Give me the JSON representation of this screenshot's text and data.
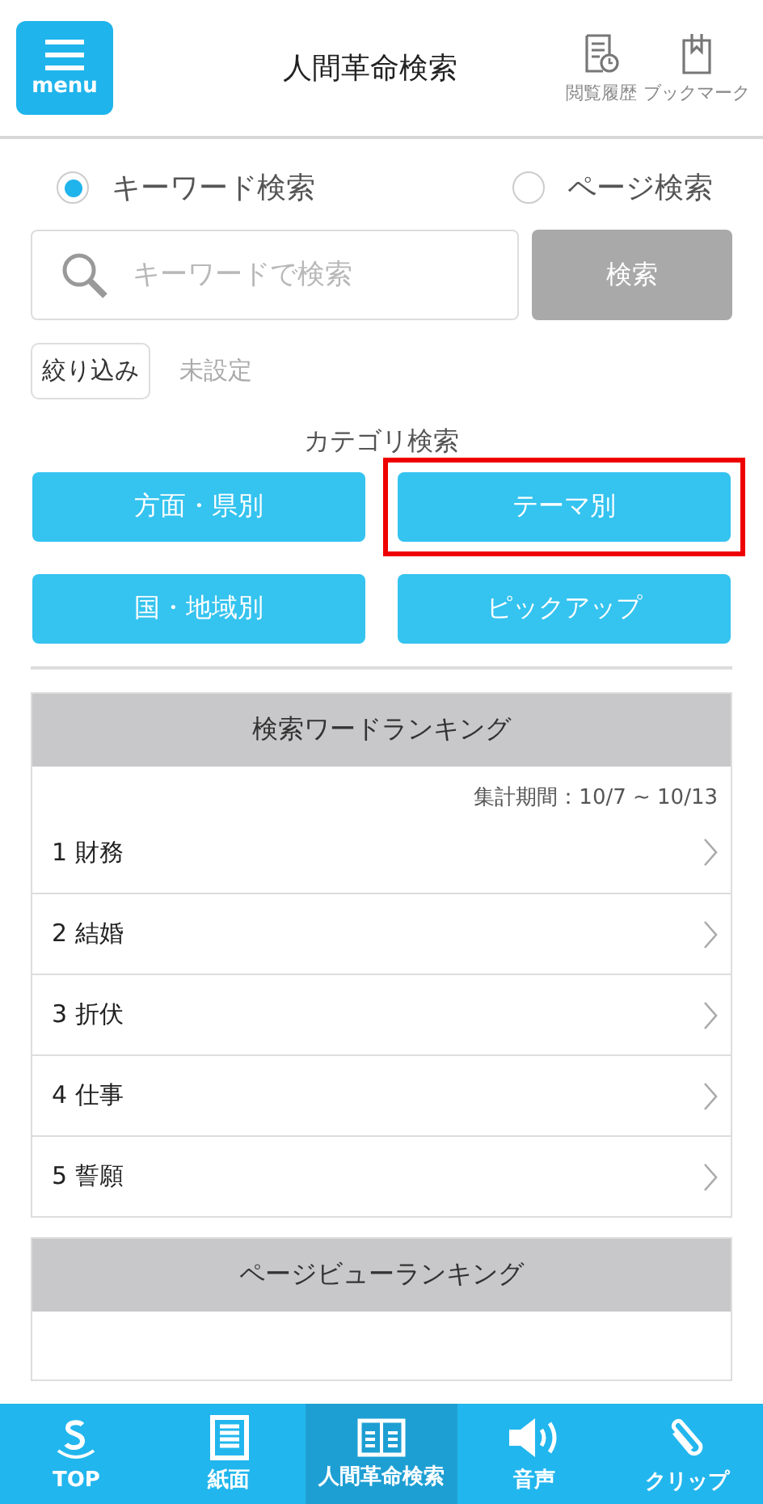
{
  "header": {
    "menu_label": "menu",
    "title": "人間革命検索",
    "actions": [
      {
        "kind": "history",
        "label": "閲覧履歴"
      },
      {
        "kind": "bookmark",
        "label": "ブックマーク"
      }
    ]
  },
  "search_modes": [
    {
      "label": "キーワード検索",
      "selected": true
    },
    {
      "label": "ページ検索",
      "selected": false
    }
  ],
  "search": {
    "placeholder": "キーワードで検索",
    "button": "検索"
  },
  "filter": {
    "label": "絞り込み",
    "value": "未設定"
  },
  "category": {
    "title": "カテゴリ検索",
    "buttons": [
      {
        "label": "方面・県別",
        "highlighted": false
      },
      {
        "label": "テーマ別",
        "highlighted": true
      },
      {
        "label": "国・地域別",
        "highlighted": false
      },
      {
        "label": "ピックアップ",
        "highlighted": false
      }
    ]
  },
  "keyword_ranking": {
    "title": "検索ワードランキング",
    "period": "集計期間：10/7 ~ 10/13",
    "items": [
      {
        "rank": "1",
        "word": "財務"
      },
      {
        "rank": "2",
        "word": "結婚"
      },
      {
        "rank": "3",
        "word": "折伏"
      },
      {
        "rank": "4",
        "word": "仕事"
      },
      {
        "rank": "5",
        "word": "誓願"
      }
    ]
  },
  "pageview_ranking": {
    "title": "ページビューランキング"
  },
  "bottom_nav": [
    {
      "kind": "top",
      "label": "TOP",
      "selected": false
    },
    {
      "kind": "paper",
      "label": "紙面",
      "selected": false
    },
    {
      "kind": "book",
      "label": "人間革命検索",
      "selected": true
    },
    {
      "kind": "sound",
      "label": "音声",
      "selected": false
    },
    {
      "kind": "clip",
      "label": "クリップ",
      "selected": false
    }
  ]
}
